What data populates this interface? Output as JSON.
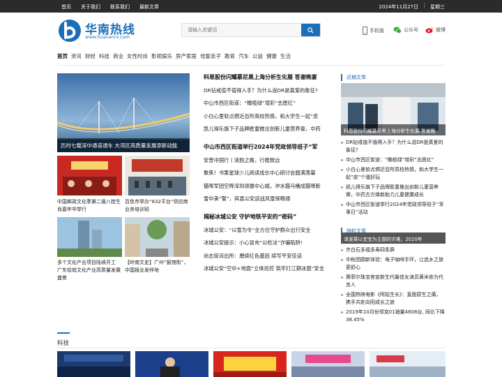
{
  "topbar": {
    "links": [
      "首页",
      "关于我们",
      "联系我们",
      "最新文章"
    ],
    "date": "2024年11月27日",
    "weekday": "星期三"
  },
  "logo": {
    "title": "华南热线",
    "subtitle": "www.huananrx.com"
  },
  "search": {
    "placeholder": "请输入关键词"
  },
  "quick": {
    "mobile": "手机版",
    "wechat": "公众号",
    "weibo": "微博"
  },
  "nav": [
    "首页",
    "资讯",
    "财经",
    "科技",
    "商业",
    "女性时尚",
    "影视娱乐",
    "房产家居",
    "母婴亲子",
    "教育",
    "汽车",
    "公益",
    "健康",
    "生活"
  ],
  "featured": {
    "caption": "历时七载深中通道通车 大湾区高质量发展添新动能"
  },
  "thumbs": [
    {
      "caption": "中国邮政文化季第二届八桂生肖嘉年华举行"
    },
    {
      "caption": "百色市举办“832平台”供应商业务培训班"
    },
    {
      "caption": "多个文化产业项目陆续开工 广东绘就文化产业高质量发展盛景"
    },
    {
      "caption": "【岭南文史】广州“报馆街”，中国报业发祥地"
    }
  ],
  "groups": [
    {
      "headline": "科恩股份闪耀慕尼黑上海分析生化展 答谢晚宴",
      "items": [
        "DR钻戒值不值得入手？为什么说DR是真爱的象征?",
        "中山市西区街道：“橄榄绿”增彩“志愿红”",
        "小白心里软点燃近百所高校热情，和大学生一起”皮",
        "凯儿得乐旗下子品牌胜童推出创新儿童营养膏，中药"
      ]
    },
    {
      "headline": "中山市西区街道举行2024年党政领导班子“军",
      "items": [
        "安普中国行丨清韵之路，行稳致远",
        "聚焦！书果星球少儿阅读成长中心研讨会圆满落幕",
        "猫咪军团空降深圳领展中心城，冲水猫马桶成猫咪新",
        "雪中美“警”，宾县公安迎战风雪保畅通"
      ]
    },
    {
      "headline": "揭秘冰城公安 守护地铁平安的“密码”",
      "items": [
        "冰城公安：“以雪为令”全方位守护群众出行安全",
        "冰城公安提示：小心冒充“公检法”诈骗陷阱!",
        "尚志街派出所：磨续红色基因 续写平安佳话",
        "冰城公安“空中+地面”立体巡控 筑牢打江期冰面”安全"
      ]
    }
  ],
  "sidebar": {
    "recent_title": "近期文章",
    "recent_caption": "科恩股份闪耀慕尼黑上海分析生化展 答谢晚",
    "recent": [
      "DR钻戒值不值得入手？为什么说DR是真爱的象征?",
      "中山市西区街道：“橄榄绿”增彩“志愿红”",
      "小白心里软点燃近百所高校热情，和大学生一起”皮”个骚好玩",
      "凯儿得乐旗下子品牌胜童推出创新儿童营养膏，中药古方焕新助力儿童健康成长",
      "中山市西区街道举行2024年党政领导班子“军事日”活动"
    ],
    "random_title": "随机文章",
    "random_caption": "津波乘以宝宝为主题的灾难，2020年",
    "random": [
      "齐白石多福多寿四条屏",
      "中秋团圆新体验：电子咖啡手环，让追乡之旅更舒心",
      "赛菲尔珠宝官宣新生代最佳女演员黄米依为代言人",
      "全国热映电影《阿姑生长》：直面原生之痛，携手共赴向阳成长之旅",
      "2019年10月份领克01销量4608台, 同比下降38.45%"
    ]
  },
  "section": {
    "title": "科技"
  }
}
